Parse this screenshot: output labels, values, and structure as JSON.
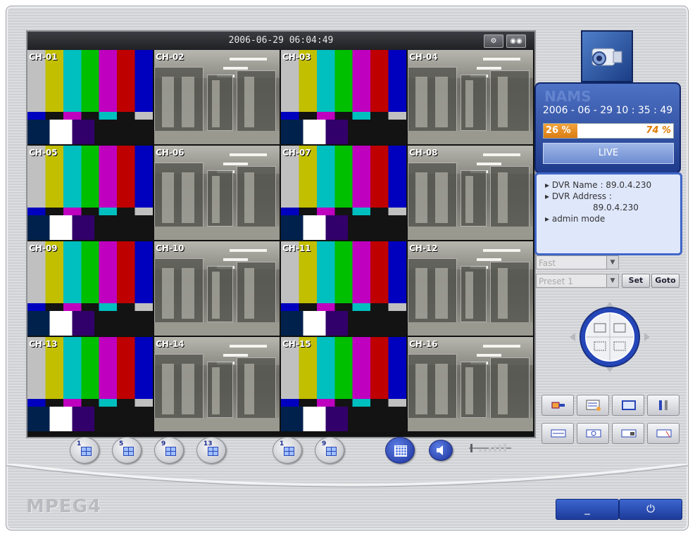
{
  "main": {
    "timestamp": "2006-06-29 06:04:49",
    "channels": [
      "CH-01",
      "CH-02",
      "CH-03",
      "CH-04",
      "CH-05",
      "CH-06",
      "CH-07",
      "CH-08",
      "CH-09",
      "CH-10",
      "CH-11",
      "CH-12",
      "CH-13",
      "CH-14",
      "CH-15",
      "CH-16"
    ],
    "channel_views": [
      "color-bars",
      "corridor",
      "color-bars",
      "corridor",
      "color-bars",
      "corridor",
      "color-bars",
      "corridor",
      "color-bars",
      "corridor",
      "color-bars",
      "corridor",
      "color-bars",
      "corridor",
      "color-bars",
      "corridor"
    ]
  },
  "layout_buttons": {
    "b1": "1",
    "b5": "5",
    "b9": "9",
    "b13": "13",
    "p1": "1",
    "p9": "9"
  },
  "status": {
    "watermark": "NAMS",
    "date": "2006 - 06 - 29  10 : 35 : 49",
    "used_label": "26 %",
    "free_label": "74 %",
    "used_fraction": 0.26,
    "live_label": "LIVE"
  },
  "info": {
    "line1": "▸ DVR Name : 89.0.4.230",
    "line2": "▸ DVR Address :",
    "line3": "89.0.4.230",
    "line4": "▸ admin mode"
  },
  "ptz": {
    "speed_select": "Fast",
    "preset_select": "Preset 1",
    "set_label": "Set",
    "goto_label": "Goto"
  },
  "brand": "MPEG4",
  "window": {
    "minimize_label": "_",
    "power_label": "⏻"
  },
  "colors": {
    "accent": "#1f3a8a",
    "disk_used": "#e38a1f"
  }
}
